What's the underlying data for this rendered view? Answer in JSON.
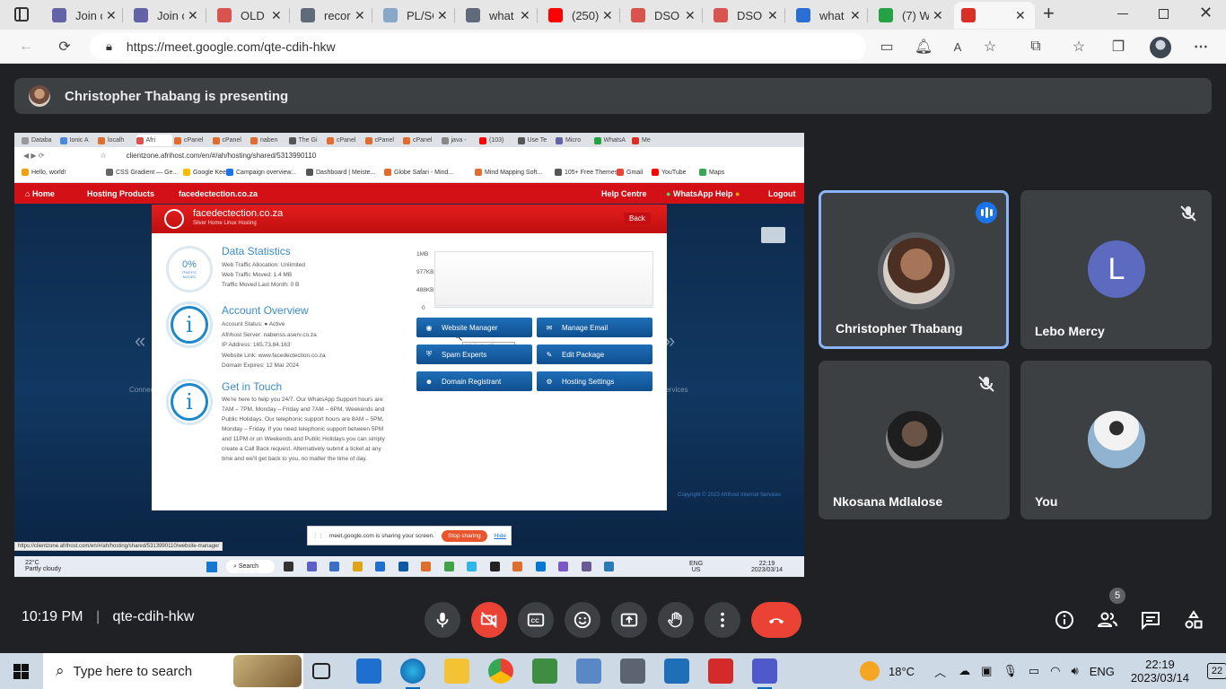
{
  "browser": {
    "tabs": [
      {
        "title": "Join c",
        "color": "#6264a7"
      },
      {
        "title": "Join c",
        "color": "#6264a7"
      },
      {
        "title": "OLD",
        "color": "#d9534f"
      },
      {
        "title": "recor",
        "color": "#5f6b7a"
      },
      {
        "title": "PL/SC",
        "color": "#89a7c9"
      },
      {
        "title": "what",
        "color": "#5f6b7a"
      },
      {
        "title": "(250)",
        "color": "#ff0000"
      },
      {
        "title": "DSO",
        "color": "#d9534f"
      },
      {
        "title": "DSO",
        "color": "#d9534f"
      },
      {
        "title": "what",
        "color": "#2a6fd6"
      },
      {
        "title": "(7) W",
        "color": "#25a244"
      },
      {
        "title": "",
        "color": "#d93025"
      }
    ],
    "url": "https://meet.google.com/qte-cdih-hkw"
  },
  "meet": {
    "presenter_text": "Christopher Thabang is presenting",
    "participants": [
      {
        "name": "Christopher Thabang",
        "speaking": true,
        "muted": false
      },
      {
        "name": "Lebo Mercy",
        "initial": "L",
        "muted": true
      },
      {
        "name": "Nkosana Mdlalose",
        "muted": true
      },
      {
        "name": "You",
        "muted": false
      }
    ],
    "time": "10:19 PM",
    "separator": "|",
    "meeting_code": "qte-cdih-hkw",
    "people_count": "5"
  },
  "shared": {
    "tabs": [
      "Databa",
      "Ionic A",
      "localh",
      "Afri",
      "cPanel",
      "cPanel",
      "naben",
      "The Gi",
      "cPanel",
      "cPanel",
      "cPanel",
      "java -",
      "(103)",
      "Use Te",
      "Micro",
      "WhatsA",
      "Me"
    ],
    "url": "clientzone.afrihost.com/en/#/ah/hosting/shared/5313990110",
    "bookmarks": [
      "Hello, world!",
      "CSS Gradient — Ge...",
      "Google Keep",
      "Campaign overview...",
      "Dashboard | Meiste...",
      "Globe Safari - Mind...",
      "Mind Mapping Soft...",
      "105+ Free Themes...",
      "Gmail",
      "YouTube",
      "Maps"
    ],
    "nav": {
      "home": "Home",
      "hosting": "Hosting Products",
      "domain": "facedectection.co.za",
      "help": "Help Centre",
      "whatsapp": "WhatsApp Help",
      "logout": "Logout"
    },
    "modal": {
      "domain": "facedectection.co.za",
      "plan": "Silver Home Linux Hosting",
      "back": "Back",
      "stats_title": "Data Statistics",
      "gauge_value": "0%",
      "gauge_label": "TRAFFIC MOVED",
      "stats_lines": [
        "Web Traffic Allocation: Unlimited",
        "Web Traffic Moved: 1.4 MB",
        "Traffic Moved Last Month: 0 B"
      ],
      "chart_labels": [
        "1MB",
        "977KB",
        "488KB",
        "0"
      ],
      "account_title": "Account Overview",
      "account_lines": [
        "Account Status: ● Active",
        "Afrihost Server: nabenss.aserv.co.za",
        "IP Address: 165.73.84.163",
        "Website Link: www.facedectection.co.za",
        "Domain Expires: 12 Mar 2024"
      ],
      "touch_title": "Get in Touch",
      "touch_lines": [
        "We're here to help you 24/7. Our WhatsApp Support hours are",
        "7AM – 7PM, Monday – Friday and 7AM – 6PM, Weekends and",
        "Public Holidays. Our telephonic support hours are 8AM – 5PM,",
        "Monday – Friday. If you need telephonic support between 5PM",
        "and 11PM or on Weekends and Public Holidays you can simply",
        "create a Call Back request. Alternatively submit a ticket at any",
        "time and we'll get back to you, no matter the time of day."
      ],
      "buttons": [
        "Website Manager",
        "Manage Email",
        "Spam Experts",
        "Edit Package",
        "Domain Registrant",
        "Hosting Settings"
      ],
      "tooltip": "Website Manager"
    },
    "bg_left": "Connect",
    "bg_right": "Services",
    "share_banner": "meet.google.com is sharing your screen.",
    "stop_sharing": "Stop sharing",
    "hide": "Hide",
    "status_url": "https://clientzone.afrihost.com/en/#/ah/hosting/shared/5313990110/website-manager",
    "copyright": "Copyright © 2023 Afrihost Internet Services",
    "taskbar": {
      "weather_temp": "22°C",
      "weather_desc": "Partly cloudy",
      "search": "Search",
      "lang": "ENG",
      "region": "US",
      "time": "22:19",
      "date": "2023/03/14"
    }
  },
  "taskbar": {
    "search_placeholder": "Type here to search",
    "temp": "18°C",
    "lang": "ENG",
    "time": "22:19",
    "date": "2023/03/14",
    "notifications": "22"
  }
}
